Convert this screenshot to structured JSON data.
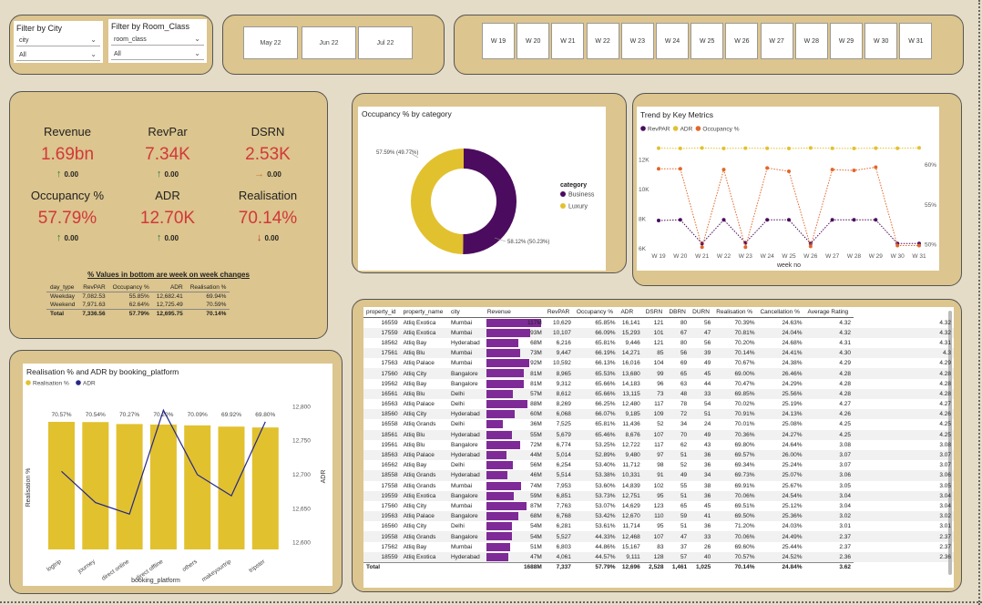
{
  "filters": {
    "city": {
      "title": "Filter by City",
      "field": "city",
      "value": "All"
    },
    "room_class": {
      "title": "Filter by Room_Class",
      "field": "room_class",
      "value": "All"
    }
  },
  "months": [
    "May 22",
    "Jun 22",
    "Jul 22"
  ],
  "weeks": [
    "W 19",
    "W 20",
    "W 21",
    "W 22",
    "W 23",
    "W 24",
    "W 25",
    "W 26",
    "W 27",
    "W 28",
    "W 29",
    "W 30",
    "W 31"
  ],
  "kpis": [
    {
      "label": "Revenue",
      "value": "1.69bn",
      "delta": "0.00",
      "dir": "up"
    },
    {
      "label": "RevPar",
      "value": "7.34K",
      "delta": "0.00",
      "dir": "up"
    },
    {
      "label": "DSRN",
      "value": "2.53K",
      "delta": "0.00",
      "dir": "right"
    },
    {
      "label": "Occupancy %",
      "value": "57.79%",
      "delta": "0.00",
      "dir": "up"
    },
    {
      "label": "ADR",
      "value": "12.70K",
      "delta": "0.00",
      "dir": "up"
    },
    {
      "label": "Realisation",
      "value": "70.14%",
      "delta": "0.00",
      "dir": "down"
    }
  ],
  "wow": {
    "title": "% Values in bottom are week on week changes",
    "headers": [
      "day_type",
      "RevPAR",
      "Occupancy %",
      "ADR",
      "Realisation %"
    ],
    "rows": [
      [
        "Weekday",
        "7,082.53",
        "55.85%",
        "12,682.41",
        "69.94%"
      ],
      [
        "Weekend",
        "7,971.63",
        "62.64%",
        "12,725.49",
        "70.59%"
      ],
      [
        "Total",
        "7,336.56",
        "57.79%",
        "12,695.75",
        "70.14%"
      ]
    ]
  },
  "donut": {
    "title": "Occupancy % by category",
    "legend_title": "category",
    "label_left": "57.59% (49.77%)",
    "label_right": "58.12% (50.23%)"
  },
  "trend": {
    "title": "Trend by Key Metrics",
    "xlabel": "week no",
    "y_left_ticks": [
      "12K",
      "10K",
      "8K",
      "6K"
    ],
    "y_right_ticks": [
      "60%",
      "55%",
      "50%"
    ]
  },
  "booking": {
    "title": "Realisation % and ADR by booking_platform",
    "xlabel": "booking_platform",
    "ylabel_left": "Realisation %",
    "ylabel_right": "ADR",
    "y_right_ticks": [
      "12,800",
      "12,750",
      "12,700",
      "12,650",
      "12,600"
    ]
  },
  "chart_data": [
    {
      "type": "pie",
      "title": "Occupancy % by category",
      "categories": [
        "Business",
        "Luxury"
      ],
      "values": [
        58.12,
        57.59
      ],
      "share": [
        50.23,
        49.77
      ],
      "colors": [
        "#4b0b5e",
        "#e2c12f"
      ]
    },
    {
      "type": "line",
      "title": "Trend by Key Metrics",
      "x": [
        "W 19",
        "W 20",
        "W 21",
        "W 22",
        "W 23",
        "W 24",
        "W 25",
        "W 26",
        "W 27",
        "W 28",
        "W 29",
        "W 30",
        "W 31"
      ],
      "xlabel": "week no",
      "series": [
        {
          "name": "RevPAR",
          "axis": "left",
          "color": "#4b0b5e",
          "values": [
            7900,
            7950,
            6350,
            7950,
            6400,
            7950,
            7950,
            6350,
            7950,
            7950,
            7950,
            6350,
            6350
          ]
        },
        {
          "name": "ADR",
          "axis": "left",
          "color": "#e2c12f",
          "values": [
            12780,
            12760,
            12790,
            12760,
            12780,
            12770,
            12760,
            12790,
            12770,
            12760,
            12780,
            12770,
            12800
          ]
        },
        {
          "name": "Occupancy %",
          "axis": "right",
          "color": "#e2672a",
          "values": [
            59.5,
            59.5,
            49.7,
            59.4,
            49.7,
            59.6,
            59.2,
            49.8,
            59.4,
            59.3,
            59.7,
            49.9,
            49.9
          ]
        }
      ],
      "ylim_left": [
        6000,
        13000
      ],
      "ylim_right": [
        49.5,
        62.5
      ]
    },
    {
      "type": "bar",
      "title": "Realisation % and ADR by booking_platform",
      "categories": [
        "logtrip",
        "journey",
        "direct online",
        "direct offline",
        "others",
        "makeyourtrip",
        "tripster"
      ],
      "xlabel": "booking_platform",
      "series": [
        {
          "name": "Realisation %",
          "color": "#e2c12f",
          "values": [
            70.57,
            70.54,
            70.27,
            70.2,
            70.09,
            69.92,
            69.8
          ]
        },
        {
          "name": "ADR",
          "color": "#24278a",
          "values": [
            12705,
            12659,
            12642,
            12795,
            12700,
            12669,
            12778
          ]
        }
      ],
      "ylim_right": [
        12590,
        12810
      ]
    }
  ],
  "table": {
    "headers": [
      "property_id",
      "property_name",
      "city",
      "Revenue",
      "RevPAR",
      "Occupancy %",
      "ADR",
      "DSRN",
      "DBRN",
      "DURN",
      "Realisation %",
      "Cancellation %",
      "Average Rating"
    ],
    "rows": [
      [
        "16559",
        "Atliq Exotica",
        "Mumbai",
        "117M",
        117,
        "10,629",
        "65.85%",
        "16,141",
        "121",
        "80",
        "56",
        "70.39%",
        "24.63%",
        "4.32",
        4.32
      ],
      [
        "17559",
        "Atliq Exotica",
        "Mumbai",
        "93M",
        93,
        "10,107",
        "66.09%",
        "15,293",
        "101",
        "67",
        "47",
        "70.81%",
        "24.04%",
        "4.32",
        4.32
      ],
      [
        "18562",
        "Atliq Bay",
        "Hyderabad",
        "68M",
        68,
        "6,216",
        "65.81%",
        "9,446",
        "121",
        "80",
        "56",
        "70.20%",
        "24.68%",
        "4.31",
        4.31
      ],
      [
        "17561",
        "Atliq Blu",
        "Mumbai",
        "73M",
        73,
        "9,447",
        "66.19%",
        "14,271",
        "85",
        "56",
        "39",
        "70.14%",
        "24.41%",
        "4.30",
        4.3
      ],
      [
        "17563",
        "Atliq Palace",
        "Mumbai",
        "92M",
        92,
        "10,592",
        "66.13%",
        "16,016",
        "104",
        "69",
        "49",
        "70.67%",
        "24.38%",
        "4.29",
        4.29
      ],
      [
        "17560",
        "Atliq City",
        "Bangalore",
        "81M",
        81,
        "8,965",
        "65.53%",
        "13,680",
        "99",
        "65",
        "45",
        "69.00%",
        "26.46%",
        "4.28",
        4.28
      ],
      [
        "19562",
        "Atliq Bay",
        "Bangalore",
        "81M",
        81,
        "9,312",
        "65.66%",
        "14,183",
        "96",
        "63",
        "44",
        "70.47%",
        "24.29%",
        "4.28",
        4.28
      ],
      [
        "16561",
        "Atliq Blu",
        "Delhi",
        "57M",
        57,
        "8,612",
        "65.66%",
        "13,115",
        "73",
        "48",
        "33",
        "69.85%",
        "25.56%",
        "4.28",
        4.28
      ],
      [
        "16563",
        "Atliq Palace",
        "Delhi",
        "88M",
        88,
        "8,269",
        "66.25%",
        "12,480",
        "117",
        "78",
        "54",
        "70.02%",
        "25.19%",
        "4.27",
        4.27
      ],
      [
        "18560",
        "Atliq City",
        "Hyderabad",
        "60M",
        60,
        "6,068",
        "66.07%",
        "9,185",
        "109",
        "72",
        "51",
        "70.91%",
        "24.13%",
        "4.26",
        4.26
      ],
      [
        "16558",
        "Atliq Grands",
        "Delhi",
        "36M",
        36,
        "7,525",
        "65.81%",
        "11,436",
        "52",
        "34",
        "24",
        "70.01%",
        "25.08%",
        "4.25",
        4.25
      ],
      [
        "18561",
        "Atliq Blu",
        "Hyderabad",
        "55M",
        55,
        "5,679",
        "65.46%",
        "8,676",
        "107",
        "70",
        "49",
        "70.36%",
        "24.27%",
        "4.25",
        4.25
      ],
      [
        "19561",
        "Atliq Blu",
        "Bangalore",
        "72M",
        72,
        "6,774",
        "53.25%",
        "12,722",
        "117",
        "62",
        "43",
        "69.80%",
        "24.64%",
        "3.08",
        3.08
      ],
      [
        "18563",
        "Atliq Palace",
        "Hyderabad",
        "44M",
        44,
        "5,014",
        "52.89%",
        "9,480",
        "97",
        "51",
        "36",
        "69.57%",
        "26.00%",
        "3.07",
        3.07
      ],
      [
        "16562",
        "Atliq Bay",
        "Delhi",
        "56M",
        56,
        "6,254",
        "53.40%",
        "11,712",
        "98",
        "52",
        "36",
        "69.34%",
        "25.24%",
        "3.07",
        3.07
      ],
      [
        "18558",
        "Atliq Grands",
        "Hyderabad",
        "46M",
        46,
        "5,514",
        "53.38%",
        "10,331",
        "91",
        "49",
        "34",
        "69.73%",
        "25.07%",
        "3.06",
        3.06
      ],
      [
        "17558",
        "Atliq Grands",
        "Mumbai",
        "74M",
        74,
        "7,953",
        "53.60%",
        "14,839",
        "102",
        "55",
        "38",
        "69.91%",
        "25.67%",
        "3.05",
        3.05
      ],
      [
        "19559",
        "Atliq Exotica",
        "Bangalore",
        "59M",
        59,
        "6,851",
        "53.73%",
        "12,751",
        "95",
        "51",
        "36",
        "70.06%",
        "24.54%",
        "3.04",
        3.04
      ],
      [
        "17560",
        "Atliq City",
        "Mumbai",
        "87M",
        87,
        "7,763",
        "53.07%",
        "14,629",
        "123",
        "65",
        "45",
        "69.51%",
        "25.12%",
        "3.04",
        3.04
      ],
      [
        "19563",
        "Atliq Palace",
        "Bangalore",
        "68M",
        68,
        "6,768",
        "53.42%",
        "12,670",
        "110",
        "59",
        "41",
        "69.50%",
        "25.36%",
        "3.02",
        3.02
      ],
      [
        "16560",
        "Atliq City",
        "Delhi",
        "54M",
        54,
        "6,281",
        "53.61%",
        "11,714",
        "95",
        "51",
        "36",
        "71.20%",
        "24.03%",
        "3.01",
        3.01
      ],
      [
        "19558",
        "Atliq Grands",
        "Bangalore",
        "54M",
        54,
        "5,527",
        "44.33%",
        "12,468",
        "107",
        "47",
        "33",
        "70.06%",
        "24.49%",
        "2.37",
        2.37
      ],
      [
        "17562",
        "Atliq Bay",
        "Mumbai",
        "51M",
        51,
        "6,803",
        "44.86%",
        "15,167",
        "83",
        "37",
        "26",
        "69.60%",
        "25.44%",
        "2.37",
        2.37
      ],
      [
        "18559",
        "Atliq Exotica",
        "Hyderabad",
        "47M",
        47,
        "4,061",
        "44.57%",
        "9,111",
        "128",
        "57",
        "40",
        "70.57%",
        "24.52%",
        "2.36",
        2.36
      ]
    ],
    "total": [
      "Total",
      "",
      "",
      "1688M",
      "7,337",
      "57.79%",
      "12,696",
      "2,528",
      "1,461",
      "1,025",
      "70.14%",
      "24.84%",
      "3.62"
    ]
  }
}
